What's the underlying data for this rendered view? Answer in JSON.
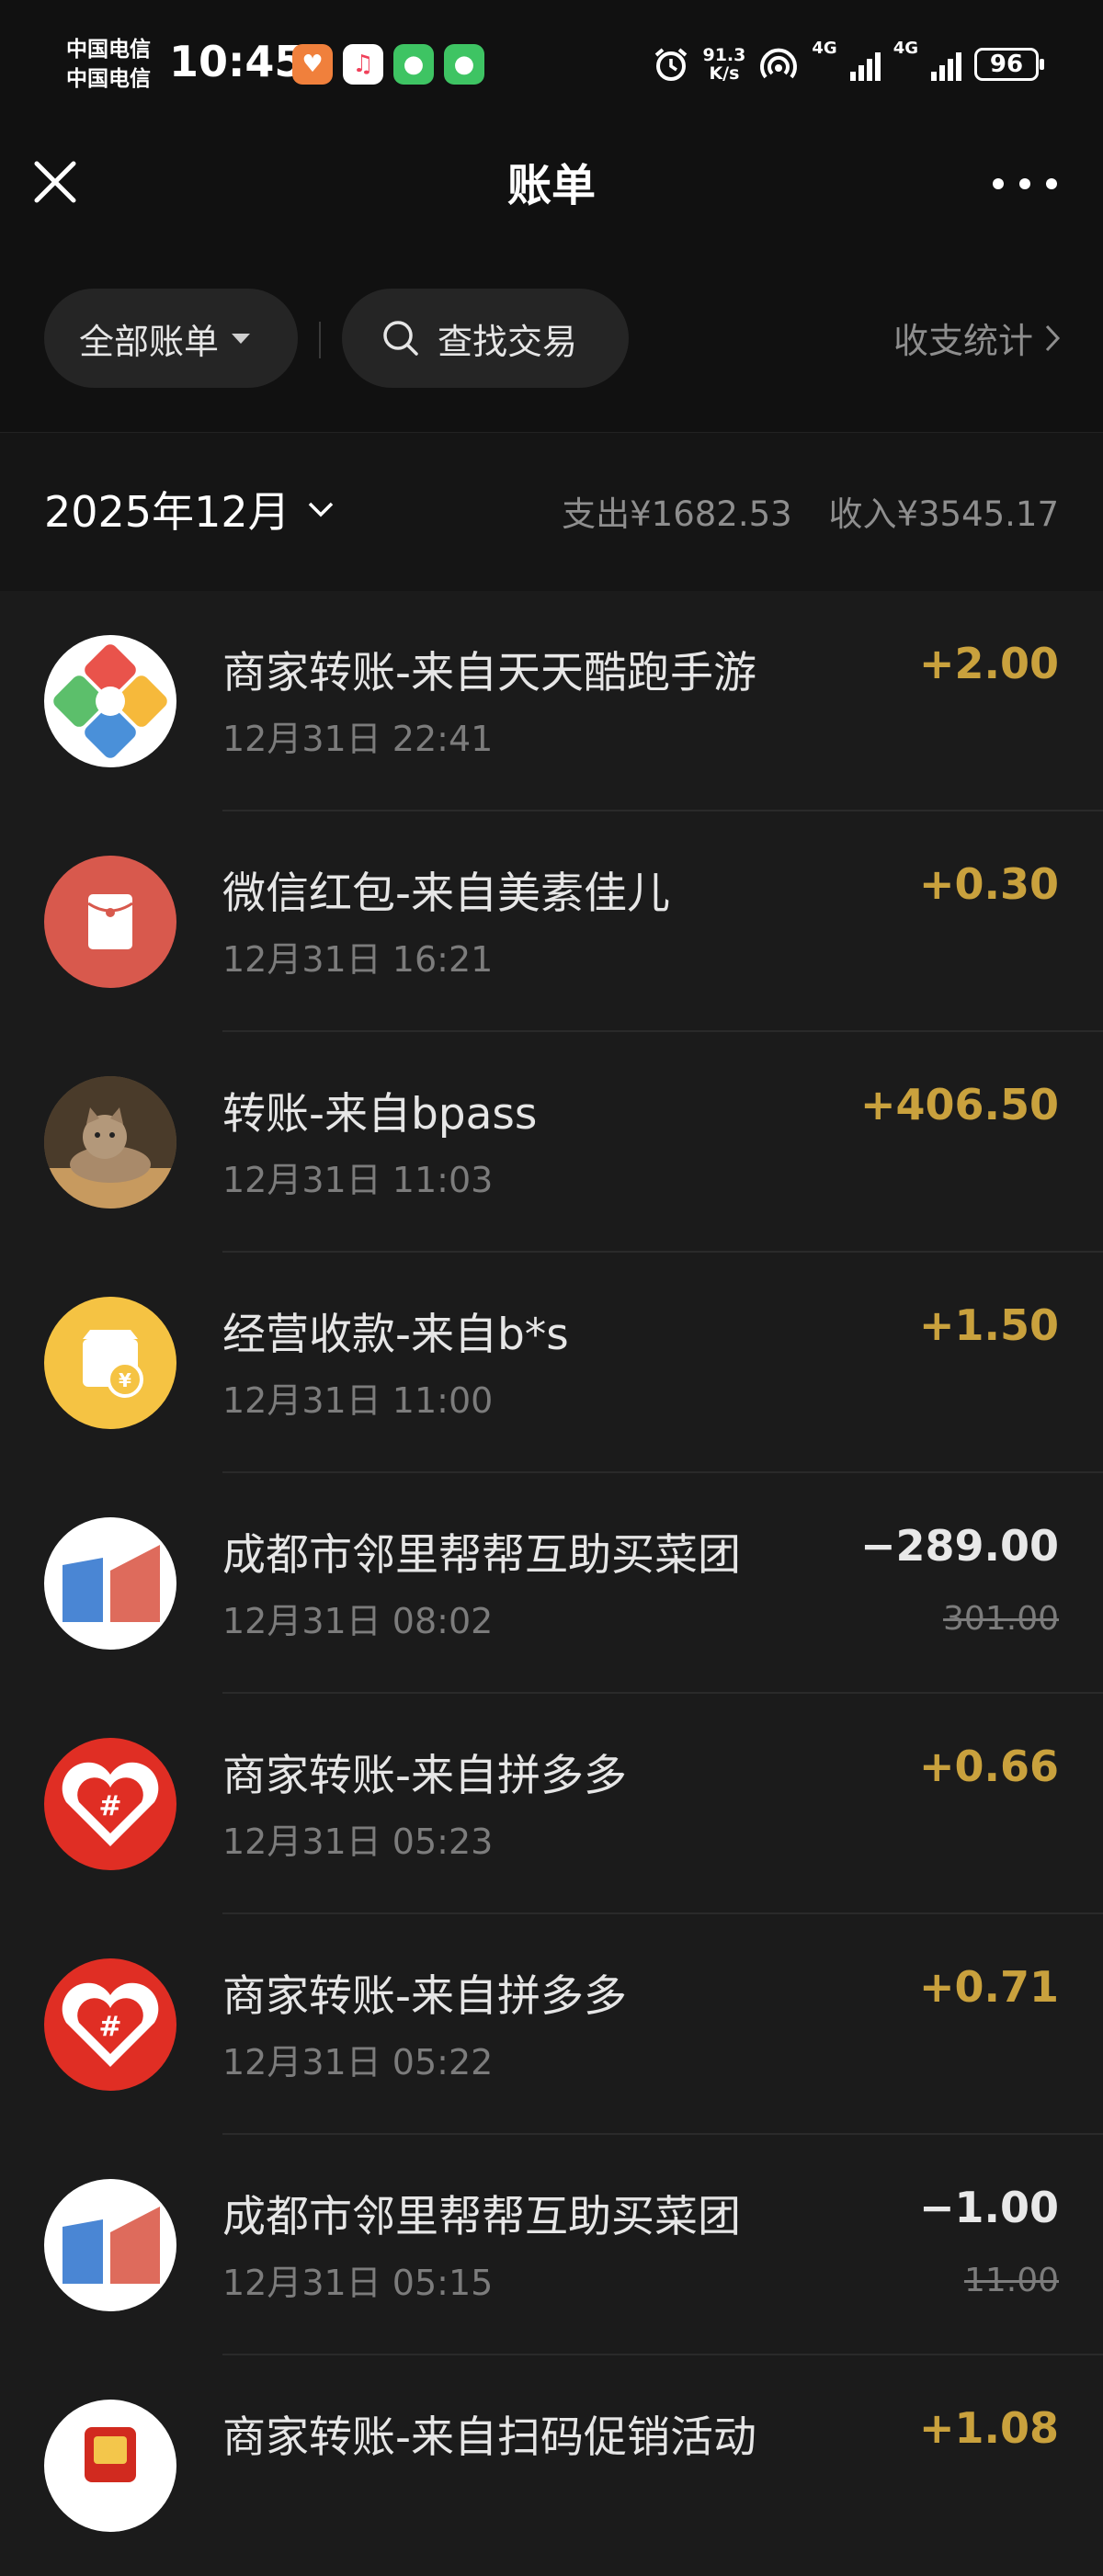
{
  "status_bar": {
    "carrier_1": "中国电信",
    "carrier_2": "中国电信",
    "time": "10:45",
    "net_speed_value": "91.3",
    "net_speed_unit": "K/s",
    "network_1": "4G",
    "network_2": "4G",
    "battery": "96"
  },
  "nav": {
    "title": "账单"
  },
  "filters": {
    "all_bills_label": "全部账单",
    "search_label": "查找交易",
    "stats_label": "收支统计"
  },
  "month": {
    "label": "2025年12月",
    "expense_summary": "支出¥1682.53",
    "income_summary": "收入¥3545.17"
  },
  "transactions": [
    {
      "title": "商家转账-来自天天酷跑手游",
      "time": "12月31日 22:41",
      "amount": "+2.00",
      "original": "",
      "icon": "tiantian-kupao-logo"
    },
    {
      "title": "微信红包-来自美素佳儿",
      "time": "12月31日 16:21",
      "amount": "+0.30",
      "original": "",
      "icon": "red-packet-icon"
    },
    {
      "title": "转账-来自bpass",
      "time": "12月31日 11:03",
      "amount": "+406.50",
      "original": "",
      "icon": "cat-avatar"
    },
    {
      "title": "经营收款-来自b*s",
      "time": "12月31日 11:00",
      "amount": "+1.50",
      "original": "",
      "icon": "shop-receipt-icon"
    },
    {
      "title": "成都市邻里帮帮互助买菜团",
      "time": "12月31日 08:02",
      "amount": "−289.00",
      "original": "301.00",
      "icon": "merchant-book-logo"
    },
    {
      "title": "商家转账-来自拼多多",
      "time": "12月31日 05:23",
      "amount": "+0.66",
      "original": "",
      "icon": "pinduoduo-logo"
    },
    {
      "title": "商家转账-来自拼多多",
      "time": "12月31日 05:22",
      "amount": "+0.71",
      "original": "",
      "icon": "pinduoduo-logo"
    },
    {
      "title": "成都市邻里帮帮互助买菜团",
      "time": "12月31日 05:15",
      "amount": "−1.00",
      "original": "11.00",
      "icon": "merchant-book-logo"
    },
    {
      "title": "商家转账-来自扫码促销活动",
      "time": "",
      "amount": "+1.08",
      "original": "",
      "icon": "promo-logo"
    }
  ],
  "colors": {
    "income": "#c9a13d",
    "expense": "#e8e8e8",
    "background": "#1b1b1b"
  }
}
